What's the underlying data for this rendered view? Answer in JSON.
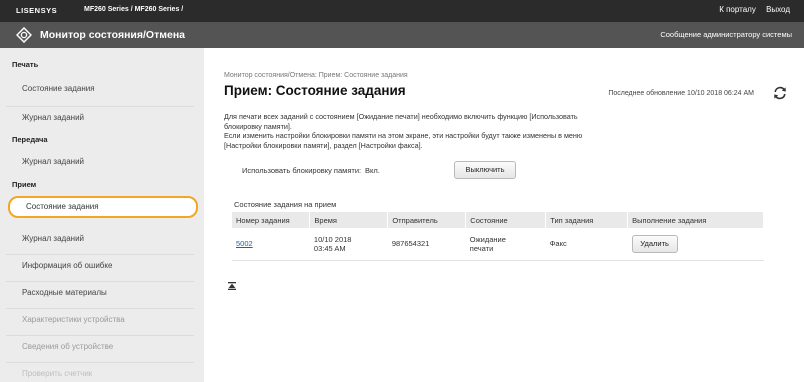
{
  "topbar": {
    "brand": "LISENSYS",
    "series": "MF260 Series / MF260 Series /",
    "links": [
      "К порталу",
      "Выход"
    ]
  },
  "titlebar": {
    "icon": "monitor-status-icon",
    "title": "Монитор состояния/Отмена",
    "message_link": "Сообщение администратору системы"
  },
  "sidebar": {
    "sections": [
      {
        "heading": "Печать",
        "items": [
          "Состояние задания",
          "Журнал заданий"
        ]
      },
      {
        "heading": "Передача",
        "items": [
          "Журнал заданий"
        ]
      },
      {
        "heading": "Прием",
        "items": [
          "Состояние задания",
          "Журнал заданий"
        ]
      }
    ],
    "extra_items": [
      "Информация об ошибке",
      "Расходные материалы",
      "Характеристики устройства",
      "Сведения об устройстве",
      "Проверить счетчик"
    ],
    "active_item": "Прием / Состояние задания",
    "active_color": "#f4a623"
  },
  "main": {
    "breadcrumb": "Монитор состояния/Отмена: Прием: Состояние задания",
    "heading": "Прием: Состояние задания",
    "last_update": "Последнее обновление 10/10 2018 06:24 AM",
    "refresh_icon": "refresh-icon",
    "note_lines": [
      "Для печати всех заданий с состоянием [Ожидание печати] необходимо включить функцию [Использовать",
      "блокировку памяти].",
      "Если изменить настройки блокировки памяти на этом экране, эти настройки будут также изменены в меню",
      "[Настройки блокировки памяти], раздел [Настройки факса]."
    ],
    "lock": {
      "label": "Использовать блокировку памяти:",
      "state": "Вкл.",
      "button": "Выключить"
    },
    "table": {
      "caption": "Состояние задания на прием",
      "columns": [
        "Номер задания",
        "Время",
        "Отправитель",
        "Состояние",
        "Тип задания",
        "Выполнение задания"
      ],
      "rows": [
        {
          "job_no": "5002",
          "time": "10/10 2018\n03:45 AM",
          "sender": "987654321",
          "status": "Ожидание\nпечати",
          "type": "Факс",
          "action": "Удалить"
        }
      ]
    },
    "bottom_icon": "to-top-icon"
  }
}
